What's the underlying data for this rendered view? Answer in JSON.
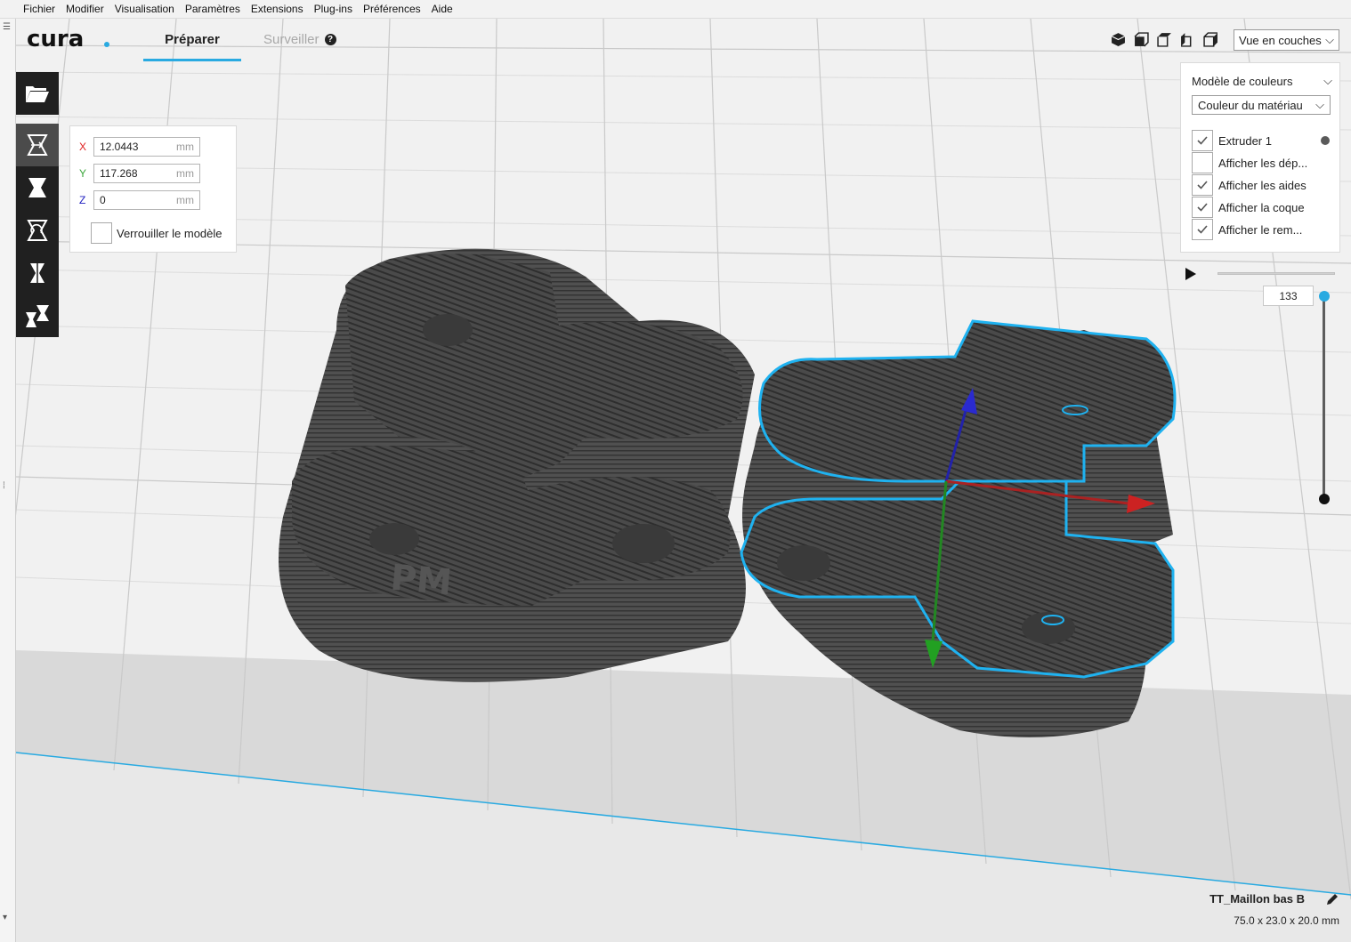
{
  "menu": [
    "Fichier",
    "Modifier",
    "Visualisation",
    "Paramètres",
    "Extensions",
    "Plug-ins",
    "Préférences",
    "Aide"
  ],
  "header": {
    "logo": "cura",
    "tabs": [
      {
        "label": "Préparer",
        "active": true
      },
      {
        "label": "Surveiller",
        "active": false
      }
    ],
    "view_buttons": [
      "3d-view-icon",
      "front-view-icon",
      "top-view-icon",
      "left-view-icon",
      "right-view-icon"
    ],
    "view_select": "Vue en couches"
  },
  "toolbar": {
    "tools": [
      "open-file-icon",
      "move-tool-icon",
      "scale-tool-icon",
      "rotate-tool-icon",
      "mirror-tool-icon",
      "per-model-settings-icon"
    ],
    "active_tool": "move-tool-icon"
  },
  "move_panel": {
    "x": {
      "axis": "X",
      "value": "12.0443",
      "unit": "mm",
      "color": "#e02020"
    },
    "y": {
      "axis": "Y",
      "value": "117.268",
      "unit": "mm",
      "color": "#3aa63a"
    },
    "z": {
      "axis": "Z",
      "value": "0",
      "unit": "mm",
      "color": "#2020c0"
    },
    "lock_label": "Verrouiller le modèle",
    "lock_checked": false
  },
  "color_panel": {
    "title": "Modèle de couleurs",
    "scheme": "Couleur du matériau",
    "options": [
      {
        "label": "Extruder 1",
        "checked": true
      },
      {
        "label": "Afficher les dép...",
        "checked": false
      },
      {
        "label": "Afficher les aides",
        "checked": true
      },
      {
        "label": "Afficher la coque",
        "checked": true
      },
      {
        "label": "Afficher le rem...",
        "checked": true
      }
    ]
  },
  "layer_slider": {
    "current_layer": "133"
  },
  "model": {
    "name": "TT_Maillon bas B",
    "dimensions": "75.0 x 23.0 x 20.0 mm",
    "engraving": "PM"
  },
  "colors": {
    "accent": "#29aae1",
    "toolbar_bg": "#202020",
    "model": "#4a4a4a",
    "selection_outline": "#1fb2f0"
  }
}
